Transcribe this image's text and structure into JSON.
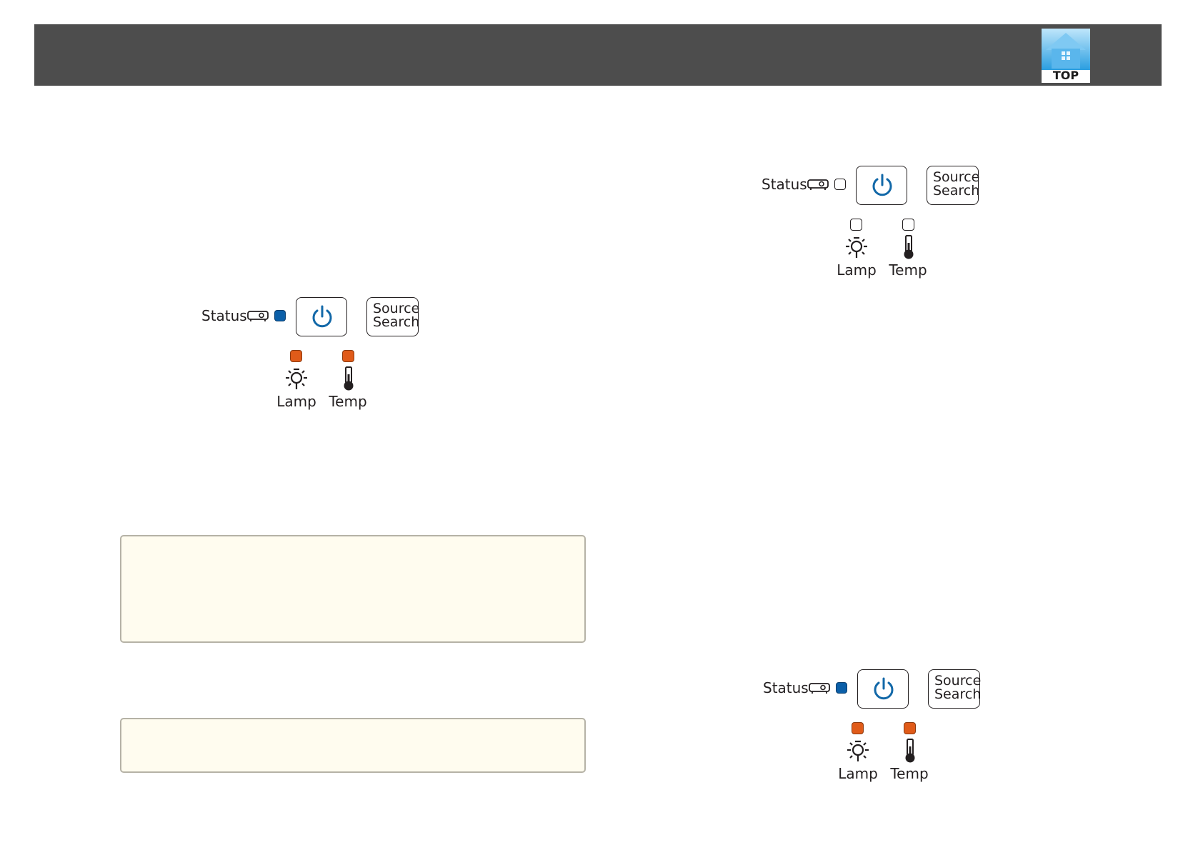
{
  "header": {
    "top_button_label": "TOP"
  },
  "panels": [
    {
      "id": "panel-top-right",
      "status_label": "Status",
      "status_led": "off",
      "power_icon": "power-icon",
      "source_search_label": [
        "Source",
        "Search"
      ],
      "lamp_label": "Lamp",
      "temp_label": "Temp",
      "lamp_led": "off",
      "temp_led": "off"
    },
    {
      "id": "panel-middle-left",
      "status_label": "Status",
      "status_led": "blue",
      "power_icon": "power-icon",
      "source_search_label": [
        "Source",
        "Search"
      ],
      "lamp_label": "Lamp",
      "temp_label": "Temp",
      "lamp_led": "orange",
      "temp_led": "orange"
    },
    {
      "id": "panel-bottom-right",
      "status_label": "Status",
      "status_led": "blue",
      "power_icon": "power-icon",
      "source_search_label": [
        "Source",
        "Search"
      ],
      "lamp_label": "Lamp",
      "temp_label": "Temp",
      "lamp_led": "orange",
      "temp_led": "orange"
    }
  ],
  "colors": {
    "header": "#4d4d4d",
    "led_orange": "#e05b19",
    "led_blue": "#0b5fa8",
    "power_symbol": "#1268a8",
    "note_background": "#fffcef",
    "note_border": "#b5b2a6"
  }
}
